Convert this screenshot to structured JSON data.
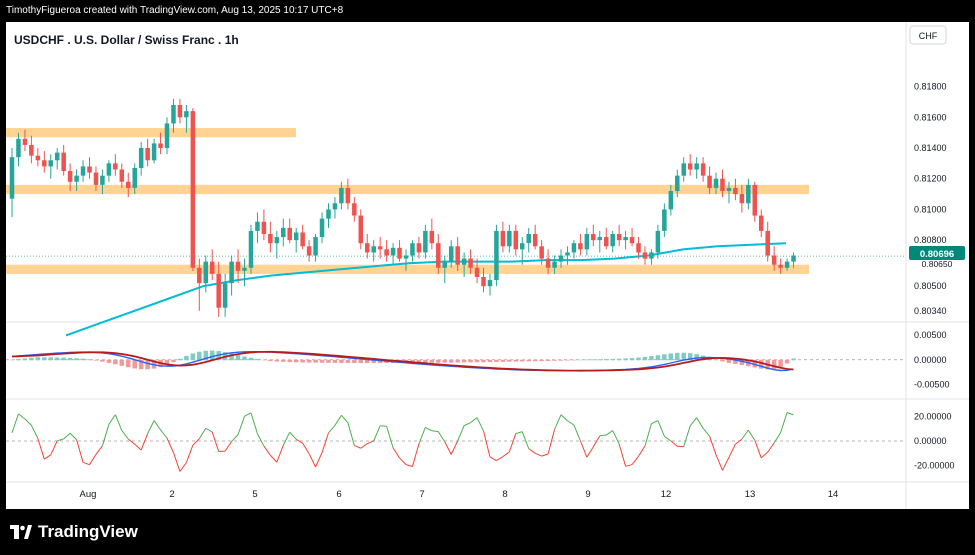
{
  "header": {
    "credit": "TimothyFigueroa created with TradingView.com, Aug 13, 2025 10:17 UTC+8"
  },
  "footer": {
    "brand": "TradingView"
  },
  "chart_data": {
    "type": "candlestick",
    "title": "USDCHF . U.S. Dollar / Swiss Franc . 1h",
    "currency_label": "CHF",
    "price_axis": {
      "ticks": [
        "0.81800",
        "0.81600",
        "0.81400",
        "0.81200",
        "0.81000",
        "0.80800",
        "0.80500",
        "0.80340"
      ],
      "ylim": [
        0.8028,
        0.8196
      ]
    },
    "last_price": "0.80696",
    "last_price_secondary": "0.80650",
    "x_ticks": [
      "Aug",
      "2",
      "5",
      "6",
      "7",
      "8",
      "9",
      "12",
      "13",
      "14"
    ],
    "zones": [
      {
        "from": 0.8147,
        "to": 0.8153,
        "extent": "left"
      },
      {
        "from": 0.811,
        "to": 0.8116,
        "extent": "wide"
      },
      {
        "from": 0.8058,
        "to": 0.8064,
        "extent": "wide"
      }
    ],
    "candles": [
      [
        0.8107,
        0.814,
        0.8095,
        0.8134
      ],
      [
        0.8134,
        0.815,
        0.8128,
        0.8146
      ],
      [
        0.8146,
        0.8152,
        0.8138,
        0.8142
      ],
      [
        0.8142,
        0.8148,
        0.813,
        0.8135
      ],
      [
        0.8135,
        0.814,
        0.8128,
        0.8132
      ],
      [
        0.8132,
        0.8138,
        0.8124,
        0.8128
      ],
      [
        0.8128,
        0.8136,
        0.812,
        0.8132
      ],
      [
        0.8132,
        0.814,
        0.8126,
        0.8137
      ],
      [
        0.8137,
        0.8142,
        0.8122,
        0.8125
      ],
      [
        0.8125,
        0.813,
        0.8112,
        0.8118
      ],
      [
        0.8118,
        0.8126,
        0.8112,
        0.8122
      ],
      [
        0.8122,
        0.8132,
        0.8118,
        0.8128
      ],
      [
        0.8128,
        0.8134,
        0.812,
        0.8124
      ],
      [
        0.8124,
        0.8128,
        0.8112,
        0.8116
      ],
      [
        0.8116,
        0.8126,
        0.811,
        0.8122
      ],
      [
        0.8122,
        0.8132,
        0.8118,
        0.813
      ],
      [
        0.813,
        0.8136,
        0.8122,
        0.8126
      ],
      [
        0.8126,
        0.813,
        0.8114,
        0.8118
      ],
      [
        0.8118,
        0.8124,
        0.8108,
        0.8114
      ],
      [
        0.8114,
        0.813,
        0.811,
        0.8127
      ],
      [
        0.8127,
        0.8144,
        0.8122,
        0.814
      ],
      [
        0.814,
        0.8146,
        0.8128,
        0.8132
      ],
      [
        0.8132,
        0.8146,
        0.813,
        0.8143
      ],
      [
        0.8143,
        0.815,
        0.8136,
        0.814
      ],
      [
        0.814,
        0.816,
        0.8136,
        0.8156
      ],
      [
        0.8156,
        0.8172,
        0.815,
        0.8168
      ],
      [
        0.8168,
        0.8172,
        0.8156,
        0.816
      ],
      [
        0.816,
        0.8168,
        0.815,
        0.8164
      ],
      [
        0.8164,
        0.8166,
        0.806,
        0.8062
      ],
      [
        0.8062,
        0.8068,
        0.8034,
        0.8052
      ],
      [
        0.8052,
        0.807,
        0.8046,
        0.8066
      ],
      [
        0.8066,
        0.8074,
        0.8054,
        0.8058
      ],
      [
        0.8058,
        0.8066,
        0.803,
        0.8036
      ],
      [
        0.8036,
        0.8058,
        0.803,
        0.8052
      ],
      [
        0.8052,
        0.807,
        0.8044,
        0.8066
      ],
      [
        0.8066,
        0.8074,
        0.8052,
        0.806
      ],
      [
        0.806,
        0.8068,
        0.805,
        0.8062
      ],
      [
        0.8062,
        0.809,
        0.8058,
        0.8086
      ],
      [
        0.8086,
        0.8098,
        0.8078,
        0.8092
      ],
      [
        0.8092,
        0.81,
        0.808,
        0.8084
      ],
      [
        0.8084,
        0.8092,
        0.8072,
        0.8078
      ],
      [
        0.8078,
        0.8086,
        0.8068,
        0.8082
      ],
      [
        0.8082,
        0.8094,
        0.8076,
        0.8088
      ],
      [
        0.8088,
        0.8094,
        0.8078,
        0.808
      ],
      [
        0.808,
        0.8088,
        0.8072,
        0.8085
      ],
      [
        0.8085,
        0.809,
        0.8074,
        0.8076
      ],
      [
        0.8076,
        0.808,
        0.8066,
        0.807
      ],
      [
        0.807,
        0.8084,
        0.8066,
        0.8082
      ],
      [
        0.8082,
        0.8098,
        0.8078,
        0.8094
      ],
      [
        0.8094,
        0.8104,
        0.8088,
        0.81
      ],
      [
        0.81,
        0.8108,
        0.8094,
        0.8104
      ],
      [
        0.8104,
        0.8118,
        0.81,
        0.8114
      ],
      [
        0.8114,
        0.812,
        0.81,
        0.8104
      ],
      [
        0.8104,
        0.8108,
        0.8092,
        0.8096
      ],
      [
        0.8096,
        0.81,
        0.8074,
        0.8078
      ],
      [
        0.8078,
        0.8084,
        0.8068,
        0.8072
      ],
      [
        0.8072,
        0.808,
        0.8066,
        0.8076
      ],
      [
        0.8076,
        0.8082,
        0.8068,
        0.8074
      ],
      [
        0.8074,
        0.808,
        0.8066,
        0.807
      ],
      [
        0.807,
        0.8078,
        0.8064,
        0.8075
      ],
      [
        0.8075,
        0.808,
        0.8066,
        0.8068
      ],
      [
        0.8068,
        0.8074,
        0.806,
        0.807
      ],
      [
        0.807,
        0.808,
        0.8066,
        0.8078
      ],
      [
        0.8078,
        0.8082,
        0.8068,
        0.8072
      ],
      [
        0.8072,
        0.809,
        0.8068,
        0.8086
      ],
      [
        0.8086,
        0.8094,
        0.8074,
        0.8078
      ],
      [
        0.8078,
        0.8084,
        0.8058,
        0.8062
      ],
      [
        0.8062,
        0.807,
        0.8052,
        0.8066
      ],
      [
        0.8066,
        0.808,
        0.8062,
        0.8076
      ],
      [
        0.8076,
        0.8082,
        0.806,
        0.8064
      ],
      [
        0.8064,
        0.8072,
        0.8056,
        0.8068
      ],
      [
        0.8068,
        0.8074,
        0.8058,
        0.8062
      ],
      [
        0.8062,
        0.8068,
        0.8052,
        0.8056
      ],
      [
        0.8056,
        0.8062,
        0.8046,
        0.805
      ],
      [
        0.805,
        0.8058,
        0.8044,
        0.8054
      ],
      [
        0.8054,
        0.809,
        0.805,
        0.8086
      ],
      [
        0.8086,
        0.8092,
        0.8072,
        0.8076
      ],
      [
        0.8076,
        0.809,
        0.8072,
        0.8086
      ],
      [
        0.8086,
        0.809,
        0.807,
        0.8074
      ],
      [
        0.8074,
        0.8082,
        0.8064,
        0.8078
      ],
      [
        0.8078,
        0.8088,
        0.8072,
        0.8084
      ],
      [
        0.8084,
        0.809,
        0.8074,
        0.8076
      ],
      [
        0.8076,
        0.808,
        0.8064,
        0.8068
      ],
      [
        0.8068,
        0.8074,
        0.8058,
        0.8062
      ],
      [
        0.8062,
        0.807,
        0.8058,
        0.8066
      ],
      [
        0.8066,
        0.8074,
        0.8062,
        0.807
      ],
      [
        0.807,
        0.8076,
        0.8064,
        0.8072
      ],
      [
        0.8072,
        0.808,
        0.8068,
        0.8078
      ],
      [
        0.8078,
        0.8084,
        0.807,
        0.8074
      ],
      [
        0.8074,
        0.8088,
        0.807,
        0.8084
      ],
      [
        0.8084,
        0.809,
        0.8076,
        0.808
      ],
      [
        0.808,
        0.8086,
        0.8072,
        0.8082
      ],
      [
        0.8082,
        0.8088,
        0.8074,
        0.8076
      ],
      [
        0.8076,
        0.8086,
        0.8072,
        0.8084
      ],
      [
        0.8084,
        0.809,
        0.8076,
        0.808
      ],
      [
        0.808,
        0.8086,
        0.8074,
        0.8082
      ],
      [
        0.8082,
        0.8088,
        0.8076,
        0.8078
      ],
      [
        0.8078,
        0.8082,
        0.8068,
        0.8072
      ],
      [
        0.8072,
        0.8076,
        0.8064,
        0.8068
      ],
      [
        0.8068,
        0.8074,
        0.8064,
        0.8072
      ],
      [
        0.8072,
        0.809,
        0.8068,
        0.8086
      ],
      [
        0.8086,
        0.8104,
        0.8082,
        0.81
      ],
      [
        0.81,
        0.8116,
        0.8096,
        0.8112
      ],
      [
        0.8112,
        0.8126,
        0.8108,
        0.8122
      ],
      [
        0.8122,
        0.8134,
        0.8118,
        0.813
      ],
      [
        0.813,
        0.8136,
        0.8122,
        0.8126
      ],
      [
        0.8126,
        0.8134,
        0.812,
        0.813
      ],
      [
        0.813,
        0.8134,
        0.8118,
        0.8122
      ],
      [
        0.8122,
        0.8128,
        0.811,
        0.8114
      ],
      [
        0.8114,
        0.8124,
        0.811,
        0.812
      ],
      [
        0.812,
        0.8126,
        0.8108,
        0.8112
      ],
      [
        0.8112,
        0.8118,
        0.8104,
        0.8114
      ],
      [
        0.8114,
        0.812,
        0.8106,
        0.811
      ],
      [
        0.811,
        0.8116,
        0.8098,
        0.8104
      ],
      [
        0.8104,
        0.812,
        0.81,
        0.8116
      ],
      [
        0.8116,
        0.8118,
        0.8092,
        0.8096
      ],
      [
        0.8096,
        0.81,
        0.8082,
        0.8086
      ],
      [
        0.8086,
        0.8092,
        0.8066,
        0.807
      ],
      [
        0.807,
        0.8076,
        0.806,
        0.8064
      ],
      [
        0.8064,
        0.8068,
        0.8058,
        0.8062
      ],
      [
        0.8062,
        0.8068,
        0.806,
        0.8066
      ],
      [
        0.8066,
        0.8072,
        0.8062,
        0.807
      ]
    ],
    "ma_line": {
      "color": "#00bcd4",
      "values": [
        0.8018,
        0.8026,
        0.8034,
        0.8042,
        0.805,
        0.8054,
        0.8057,
        0.8059,
        0.8061,
        0.8063,
        0.8065,
        0.8066,
        0.8066,
        0.8066,
        0.8067,
        0.8067,
        0.8068,
        0.807,
        0.8074,
        0.8076,
        0.8077,
        0.8078
      ]
    },
    "macd": {
      "ticks": [
        "0.00500",
        "0.00000",
        "-0.00500"
      ],
      "ylim": [
        -0.0075,
        0.007
      ]
    },
    "oscillator": {
      "ticks": [
        "20.00000",
        "0.00000",
        "-20.00000"
      ],
      "ylim": [
        -32,
        32
      ]
    },
    "colors": {
      "up": "#26a69a",
      "down": "#ef5350",
      "zone": "#ffcc80",
      "macd": "#2962ff",
      "signal": "#43a047",
      "signal_down": "#b71c1c",
      "osc_up": "#4caf50",
      "osc_down": "#f44336"
    }
  }
}
